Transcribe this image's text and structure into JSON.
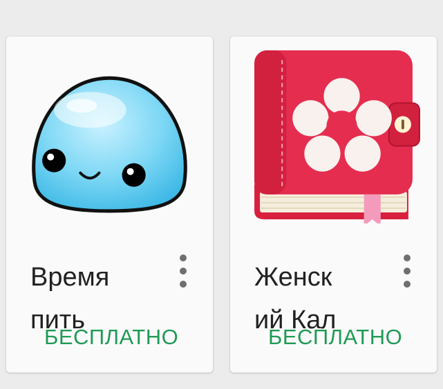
{
  "apps": [
    {
      "title_line1": "Время",
      "title_line2": "пить",
      "price": "БЕСПЛАТНО",
      "icon": "water-drop-mascot-icon"
    },
    {
      "title_line1": "Женск",
      "title_line2": "ий Кал",
      "price": "БЕСПЛАТНО",
      "icon": "flower-diary-icon"
    }
  ],
  "colors": {
    "price": "#1f9a55",
    "title": "#212121",
    "menu": "#6f6f6f",
    "card": "#fafafa",
    "background": "#ececec"
  }
}
